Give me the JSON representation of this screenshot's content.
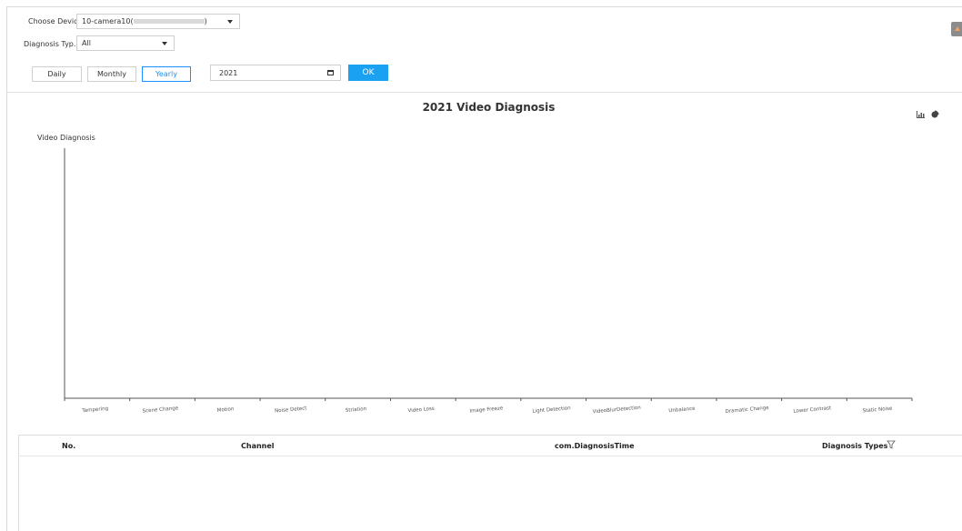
{
  "filters": {
    "device_label": "Choose Device",
    "device_value": "10-camera10(",
    "device_value_end": ")",
    "type_label": "Diagnosis Typ...",
    "type_value": "All"
  },
  "period_tabs": [
    {
      "label": "Daily",
      "active": false
    },
    {
      "label": "Monthly",
      "active": false
    },
    {
      "label": "Yearly",
      "active": true
    }
  ],
  "date_value": "2021",
  "ok_label": "OK",
  "icons": [
    "bar-chart-icon",
    "pie-chart-icon",
    "calendar-icon",
    "filter-icon"
  ],
  "colors": {
    "accent": "#1890ff",
    "ok_button": "#1ba1f2"
  },
  "chart_data": {
    "type": "bar",
    "title": "2021 Video Diagnosis",
    "ylabel": "Video Diagnosis",
    "xlabel": "",
    "categories": [
      "Tampering",
      "Scene Change",
      "Motion",
      "Noise Detect",
      "Striation",
      "Video Loss",
      "Image Freeze",
      "Light Detection",
      "VideoBlurDetection",
      "Unbalance",
      "Dramatic Change",
      "Lower Contrast",
      "Static Noise"
    ],
    "values": [],
    "grid": false
  },
  "table": {
    "columns": [
      "No.",
      "Channel",
      "com.DiagnosisTime",
      "Diagnosis Types"
    ],
    "rows": []
  }
}
